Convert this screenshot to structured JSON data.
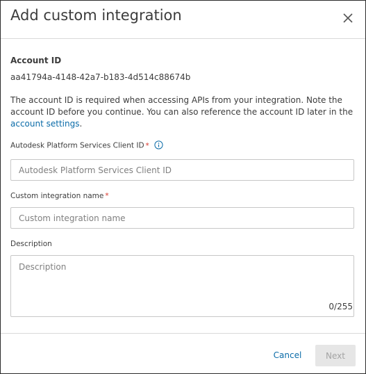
{
  "dialog": {
    "title": "Add custom integration",
    "close_icon": "close-icon"
  },
  "account": {
    "heading": "Account ID",
    "id_value": "aa41794a-4148-42a7-b183-4d514c88674b",
    "note_text": "The account ID is required when accessing APIs from your integration. Note the account ID before you continue. You can also reference the account ID later in the ",
    "note_link": "account settings",
    "note_end": "."
  },
  "fields": {
    "client_id": {
      "label": "Autodesk Platform Services Client ID",
      "required_marker": "*",
      "info_icon": "info-icon",
      "placeholder": "Autodesk Platform Services Client ID",
      "value": ""
    },
    "integration_name": {
      "label": "Custom integration name",
      "required_marker": "*",
      "placeholder": "Custom integration name",
      "value": ""
    },
    "description": {
      "label": "Description",
      "placeholder": "Description",
      "value": "",
      "counter": "0/255"
    }
  },
  "footer": {
    "cancel_label": "Cancel",
    "next_label": "Next"
  },
  "colors": {
    "link": "#0a6ba8",
    "required": "#d9362b",
    "disabled_button_bg": "#e6e6e6",
    "disabled_button_text": "#a3a3a3"
  }
}
